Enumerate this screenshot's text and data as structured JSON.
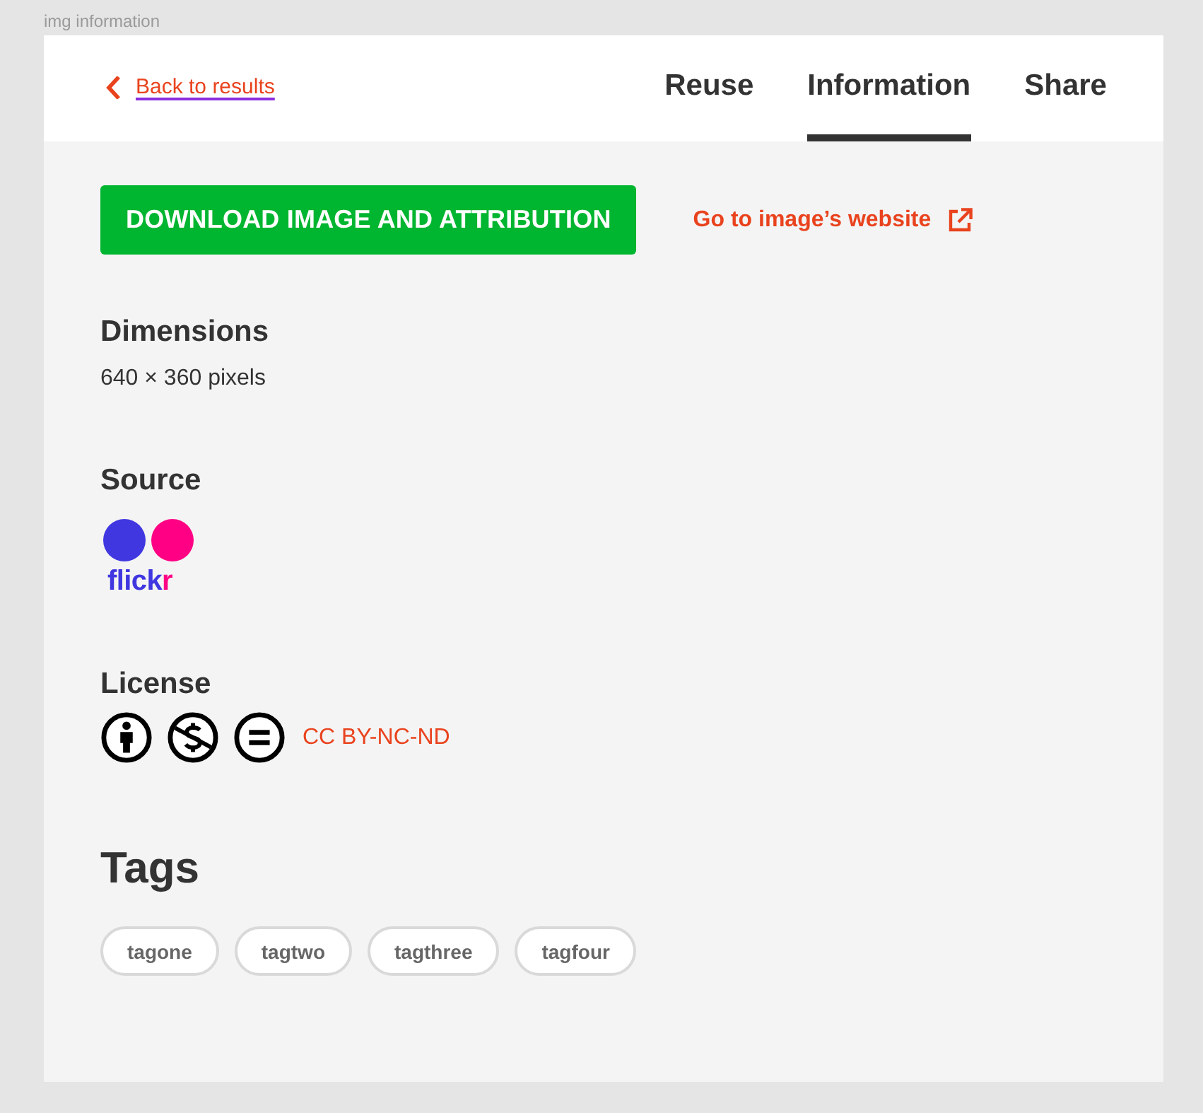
{
  "caption": "img information",
  "header": {
    "back_link": "Back to results",
    "tabs": [
      {
        "label": "Reuse",
        "selected": false
      },
      {
        "label": "Information",
        "selected": true
      },
      {
        "label": "Share",
        "selected": false
      }
    ]
  },
  "actions": {
    "download_button": "DOWNLOAD IMAGE AND ATTRIBUTION",
    "website_link": "Go to image’s website"
  },
  "dimensions": {
    "heading": "Dimensions",
    "value": "640 × 360 pixels"
  },
  "source": {
    "heading": "Source",
    "logo_text": "flickr"
  },
  "license": {
    "heading": "License",
    "link": "CC BY-NC-ND"
  },
  "tags": {
    "heading": "Tags",
    "items": [
      "tagone",
      "tagtwo",
      "tagthree",
      "tagfour"
    ]
  }
}
